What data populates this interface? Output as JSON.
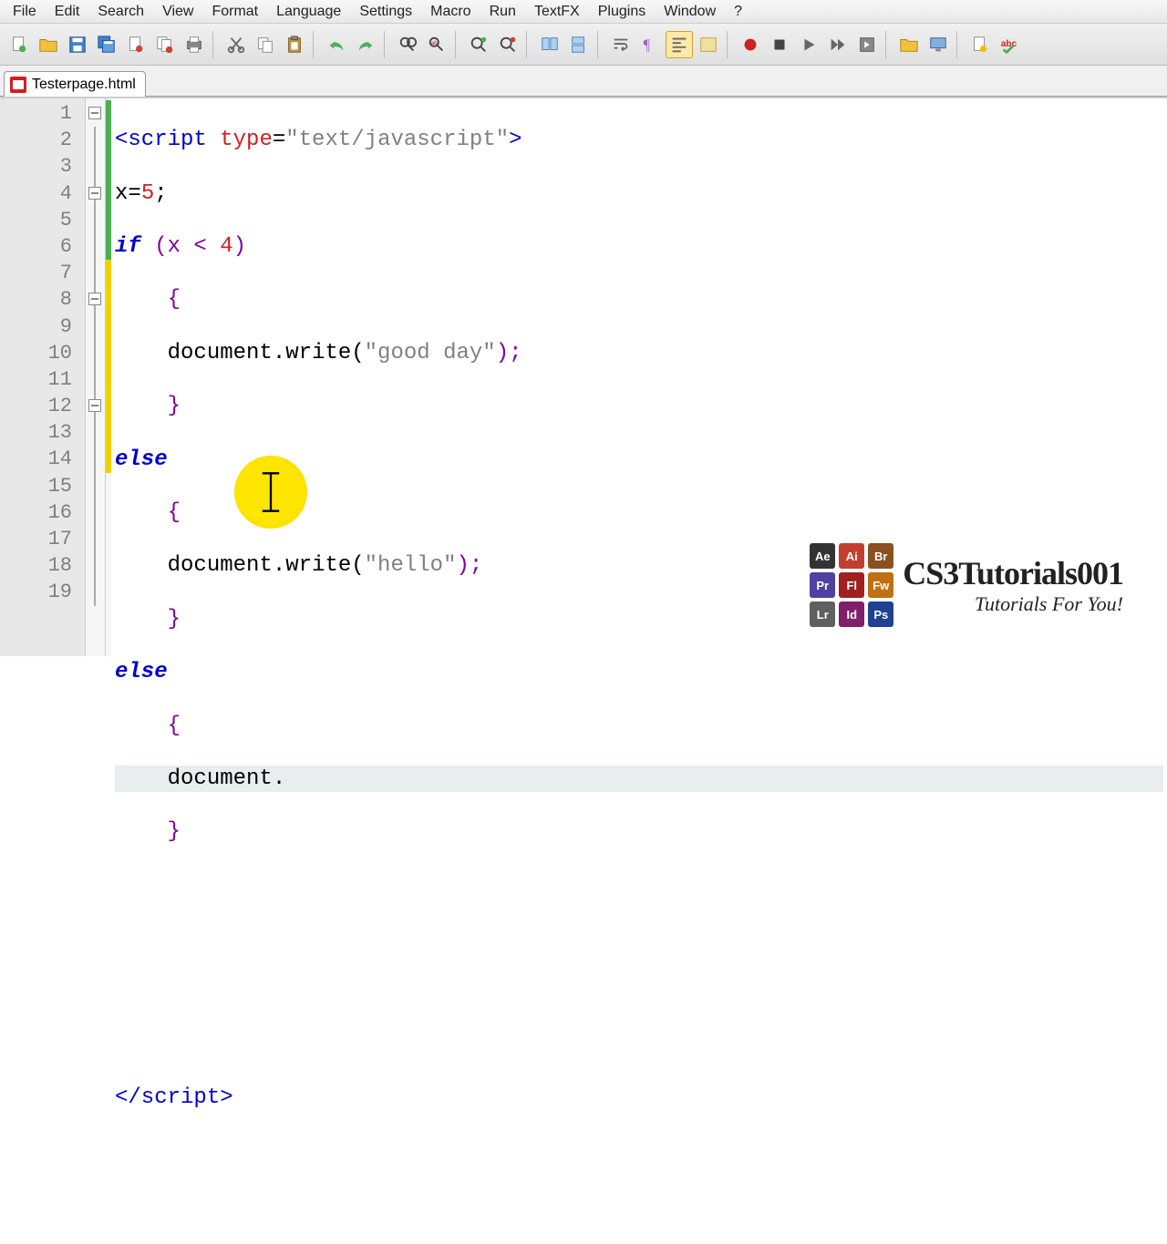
{
  "menu": [
    "File",
    "Edit",
    "Search",
    "View",
    "Format",
    "Language",
    "Settings",
    "Macro",
    "Run",
    "TextFX",
    "Plugins",
    "Window",
    "?"
  ],
  "tab": {
    "name": "Testerpage.html"
  },
  "lines": {
    "count": 19,
    "current": 13
  },
  "code": {
    "l1_open": "<script",
    "l1_attr": "type",
    "l1_eq": "=",
    "l1_val": "\"text/javascript\"",
    "l1_close": ">",
    "l2_var": "x=",
    "l2_num": "5",
    "l2_semi": ";",
    "l3_if": "if",
    "l3_open": " (x < ",
    "l3_num": "4",
    "l3_close": ")",
    "l4_brace": "    {",
    "l5_doc": "    document.write(",
    "l5_str": "\"good day\"",
    "l5_end": ");",
    "l6_brace": "    }",
    "l7_else": "else",
    "l8_brace": "    {",
    "l9_doc": "    document.write(",
    "l9_str": "\"hello\"",
    "l9_end": ");",
    "l10_brace": "    }",
    "l11_else": "else",
    "l12_brace": "    {",
    "l13_doc": "    document.",
    "l14_brace": "    }",
    "l19_close": "</script",
    "l19_gt": ">"
  },
  "watermark": {
    "title": "CS3Tutorials001",
    "sub": "Tutorials For You!",
    "icons": [
      {
        "bg": "#333333",
        "t": "Ae"
      },
      {
        "bg": "#c04030",
        "t": "Ai"
      },
      {
        "bg": "#8a5020",
        "t": "Br"
      },
      {
        "bg": "#5040a0",
        "t": "Pr"
      },
      {
        "bg": "#a02020",
        "t": "Fl"
      },
      {
        "bg": "#c07010",
        "t": "Fw"
      },
      {
        "bg": "#606060",
        "t": "Lr"
      },
      {
        "bg": "#80206a",
        "t": "Id"
      },
      {
        "bg": "#204090",
        "t": "Ps"
      }
    ]
  }
}
